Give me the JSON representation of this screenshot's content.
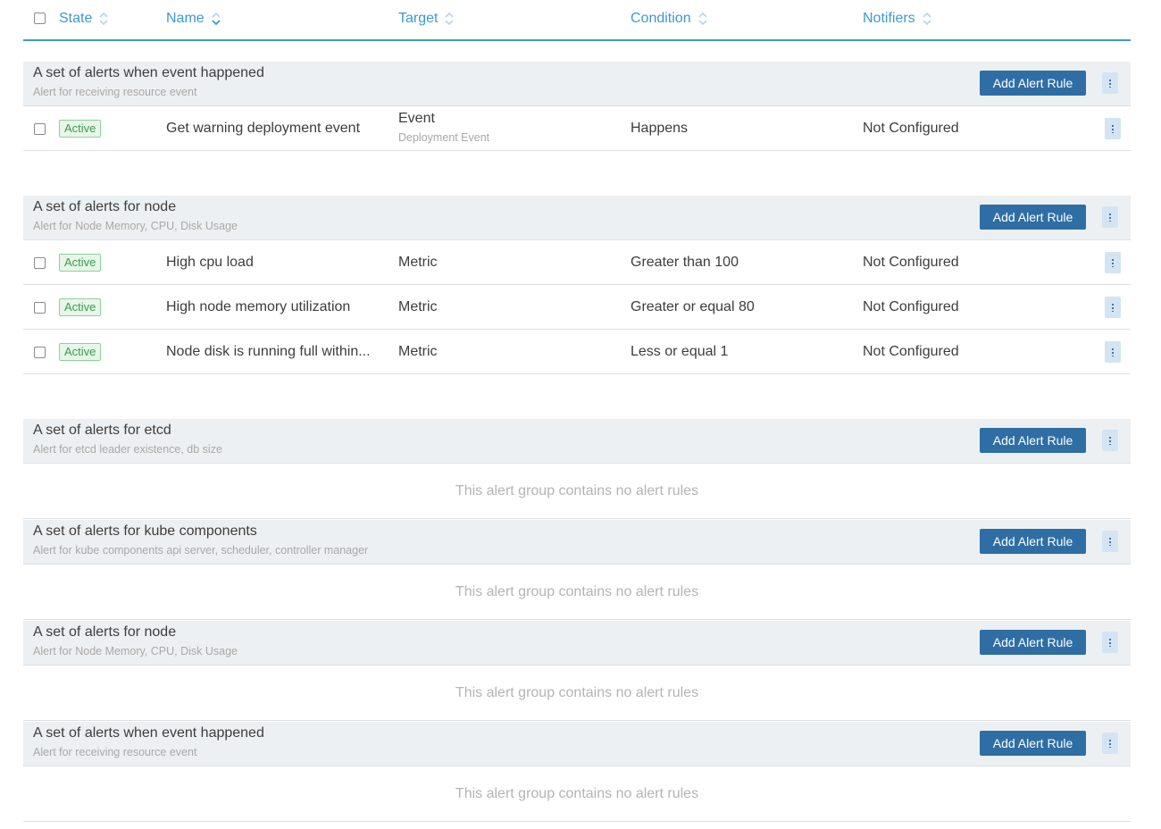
{
  "header": {
    "columns": [
      {
        "label": "State",
        "sort_icon": "sort-both-icon"
      },
      {
        "label": "Name",
        "sort_icon": "sort-desc-icon"
      },
      {
        "label": "Target",
        "sort_icon": "sort-both-icon"
      },
      {
        "label": "Condition",
        "sort_icon": "sort-both-icon"
      },
      {
        "label": "Notifiers",
        "sort_icon": "sort-both-icon"
      }
    ]
  },
  "add_button_label": "Add Alert Rule",
  "empty_message": "This alert group contains no alert rules",
  "colors": {
    "accent": "#3d98d3",
    "button": "#2f6ea5",
    "group_bg": "#edf0f2",
    "active_badge": "#3b9b4a"
  },
  "groups": [
    {
      "title": "A set of alerts when event happened",
      "description": "Alert for receiving resource event",
      "rules": [
        {
          "state": "Active",
          "name": "Get warning deployment event",
          "target": "Event",
          "target_sub": "Deployment Event",
          "condition": "Happens",
          "notifiers": "Not Configured"
        }
      ]
    },
    {
      "title": "A set of alerts for node",
      "description": "Alert for Node Memory, CPU, Disk Usage",
      "rules": [
        {
          "state": "Active",
          "name": "High cpu load",
          "target": "Metric",
          "condition": "Greater than 100",
          "notifiers": "Not Configured"
        },
        {
          "state": "Active",
          "name": "High node memory utilization",
          "target": "Metric",
          "condition": "Greater or equal 80",
          "notifiers": "Not Configured"
        },
        {
          "state": "Active",
          "name": "Node disk is running full within...",
          "target": "Metric",
          "condition": "Less or equal 1",
          "notifiers": "Not Configured"
        }
      ]
    },
    {
      "title": "A set of alerts for etcd",
      "description": "Alert for etcd leader existence, db size",
      "rules": []
    },
    {
      "title": "A set of alerts for kube components",
      "description": "Alert for kube components api server, scheduler, controller manager",
      "rules": []
    },
    {
      "title": "A set of alerts for node",
      "description": "Alert for Node Memory, CPU, Disk Usage",
      "rules": []
    },
    {
      "title": "A set of alerts when event happened",
      "description": "Alert for receiving resource event",
      "rules": []
    }
  ]
}
